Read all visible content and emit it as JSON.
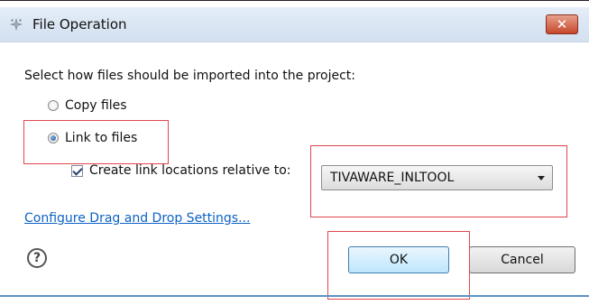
{
  "dialog": {
    "title": "File Operation",
    "close_label": "✕"
  },
  "prompt": "Select how files should be imported into the project:",
  "options": {
    "copy_files": "Copy files",
    "link_to_files": "Link to files",
    "selected": "link_to_files"
  },
  "relative": {
    "checkbox_label": "Create link locations relative to:",
    "checked": true,
    "selected_value": "TIVAWARE_INLTOOL"
  },
  "link": "Configure Drag and Drop Settings...",
  "help_label": "?",
  "buttons": {
    "ok": "OK",
    "cancel": "Cancel"
  },
  "colors": {
    "highlight": "#e0474c",
    "link": "#0b62c4"
  },
  "icons": {
    "title": "eclipse-app-icon",
    "help": "help-icon",
    "dropdown": "chevron-down-icon"
  }
}
